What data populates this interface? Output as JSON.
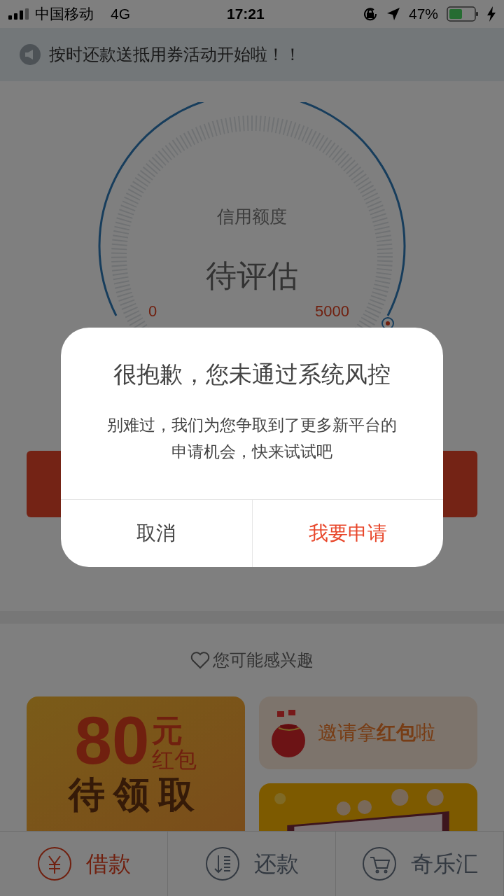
{
  "status_bar": {
    "carrier": "中国移动",
    "network": "4G",
    "time": "17:21",
    "battery": "47%"
  },
  "notice": {
    "text": "按时还款送抵用券活动开始啦！！"
  },
  "gauge": {
    "title": "信用额度",
    "value": "待评估",
    "min": "0",
    "max": "5000"
  },
  "section": {
    "title": "您可能感兴趣"
  },
  "promos": [
    {
      "kind": "coupon",
      "amount": "80",
      "unit": "元",
      "label": "红包",
      "action": "待领取"
    },
    {
      "kind": "invite",
      "text": "邀请拿**红包**啦"
    },
    {
      "kind": "picture"
    }
  ],
  "dialog": {
    "title": "很抱歉，您未通过系统风控",
    "message": "别难过，我们为您争取到了更多新平台的申请机会，快来试试吧",
    "buttons": [
      {
        "label": "取消",
        "kind": "cancel"
      },
      {
        "label": "我要申请",
        "kind": "primary"
      }
    ]
  },
  "tabs": [
    {
      "label": "借款",
      "kind": "yen",
      "selected": true
    },
    {
      "label": "还款",
      "kind": "repay",
      "selected": false
    },
    {
      "label": "奇乐汇",
      "kind": "cart",
      "selected": false
    }
  ]
}
